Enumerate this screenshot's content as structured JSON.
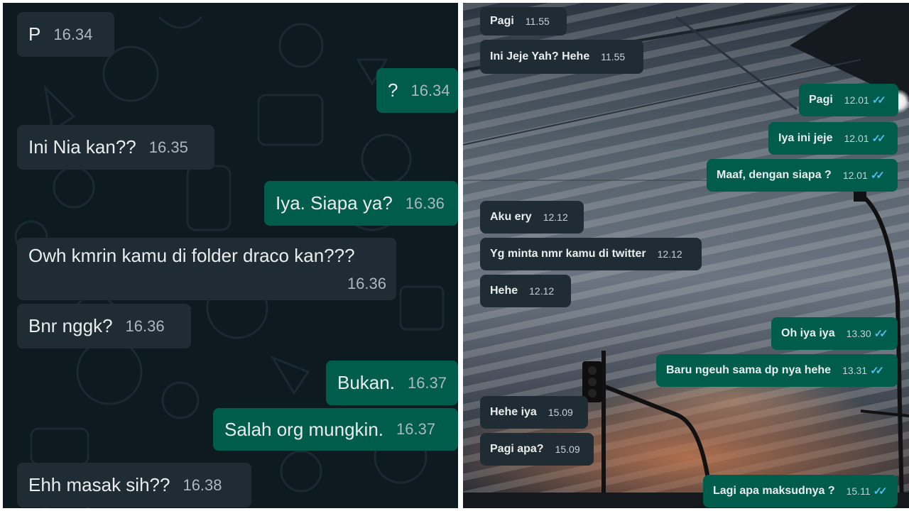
{
  "left_chat": {
    "messages": [
      {
        "dir": "in",
        "text": "P",
        "time": "16.34"
      },
      {
        "dir": "out",
        "text": "?",
        "time": "16.34"
      },
      {
        "dir": "in",
        "text": "Ini Nia kan??",
        "time": "16.35"
      },
      {
        "dir": "out",
        "text": "Iya. Siapa ya?",
        "time": "16.36"
      },
      {
        "dir": "in",
        "text": "Owh kmrin kamu di folder draco kan???",
        "time": "16.36"
      },
      {
        "dir": "in",
        "text": "Bnr nggk?",
        "time": "16.36"
      },
      {
        "dir": "out",
        "text": "Bukan.",
        "time": "16.37"
      },
      {
        "dir": "out",
        "text": "Salah org mungkin.",
        "time": "16.37"
      },
      {
        "dir": "in",
        "text": "Ehh masak sih??",
        "time": "16.38"
      }
    ]
  },
  "right_chat": {
    "messages": [
      {
        "dir": "in",
        "text": "Pagi",
        "time": "11.55"
      },
      {
        "dir": "in",
        "text": "Ini Jeje Yah? Hehe",
        "time": "11.55"
      },
      {
        "dir": "out",
        "text": "Pagi",
        "time": "12.01"
      },
      {
        "dir": "out",
        "text": "Iya ini jeje",
        "time": "12.01"
      },
      {
        "dir": "out",
        "text": "Maaf, dengan siapa ?",
        "time": "12.01"
      },
      {
        "dir": "in",
        "text": "Aku ery",
        "time": "12.12"
      },
      {
        "dir": "in",
        "text": "Yg minta nmr kamu di twitter",
        "time": "12.12"
      },
      {
        "dir": "in",
        "text": "Hehe",
        "time": "12.12"
      },
      {
        "dir": "out",
        "text": "Oh iya iya",
        "time": "13.30"
      },
      {
        "dir": "out",
        "text": "Baru ngeuh sama dp nya hehe",
        "time": "13.31"
      },
      {
        "dir": "in",
        "text": "Hehe iya",
        "time": "15.09"
      },
      {
        "dir": "in",
        "text": "Pagi apa?",
        "time": "15.09"
      },
      {
        "dir": "out",
        "text": "Lagi apa maksudnya ?",
        "time": "15.11"
      }
    ]
  },
  "colors": {
    "incoming_bubble": "#1f2c33",
    "outgoing_bubble": "#005c4b",
    "text": "#e9edef",
    "timestamp": "#aab8c0",
    "read_ticks": "#53bdeb",
    "left_background": "#0d1a20"
  },
  "icons": {
    "read_receipt": "double-check-icon"
  }
}
